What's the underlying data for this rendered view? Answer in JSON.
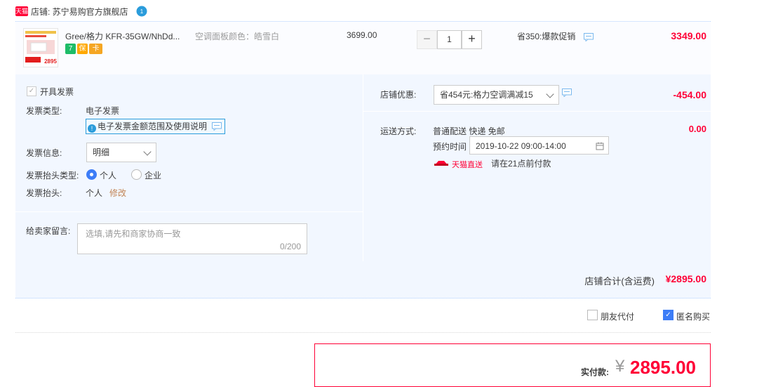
{
  "shop": {
    "logo_text": "天猫",
    "label": "店铺: 苏宁易购官方旗舰店",
    "chat_badge": "1"
  },
  "item": {
    "title": "Gree/格力 KFR-35GW/NhDd...",
    "sku": "空调面板颜色：皓雪白",
    "price": "3699.00",
    "qty_minus": "−",
    "quantity": "1",
    "qty_plus": "+",
    "promo": "省350:爆款促销",
    "total": "3349.00",
    "thumb_price": "2895",
    "badges": [
      "7",
      "保",
      "卡"
    ]
  },
  "invoice": {
    "check_label": "开具发票",
    "type_label": "发票类型:",
    "type_value": "电子发票",
    "info_link": "电子发票金额范围及使用说明",
    "info_label": "发票信息:",
    "info_value": "明细",
    "title_type_label": "发票抬头类型:",
    "option_personal": "个人",
    "option_company": "企业",
    "title_label": "发票抬头:",
    "title_value": "个人",
    "title_edit": "修改"
  },
  "message": {
    "label": "给卖家留言:",
    "placeholder": "选填,请先和商家协商一致",
    "counter": "0/200"
  },
  "discount": {
    "label": "店铺优惠:",
    "value": "省454元:格力空调满减15",
    "amount": "-454.00"
  },
  "shipping": {
    "label": "运送方式:",
    "method": "普通配送 快递 免邮",
    "amount": "0.00",
    "appoint_label": "预约时间",
    "appoint_value": "2019-10-22 09:00-14:00",
    "tmall_direct": "天猫直送",
    "pay_hint": "请在21点前付款"
  },
  "summary": {
    "label": "店铺合计(含运费)",
    "value": "¥2895.00"
  },
  "options": {
    "friend_pay": "朋友代付",
    "anonymous": "匿名购买"
  },
  "payment": {
    "label": "实付款:",
    "currency": "¥",
    "value": "2895.00"
  },
  "colors": {
    "accent": "#ff0036",
    "blue": "#3d7df7",
    "panel": "#f2f7ff"
  }
}
